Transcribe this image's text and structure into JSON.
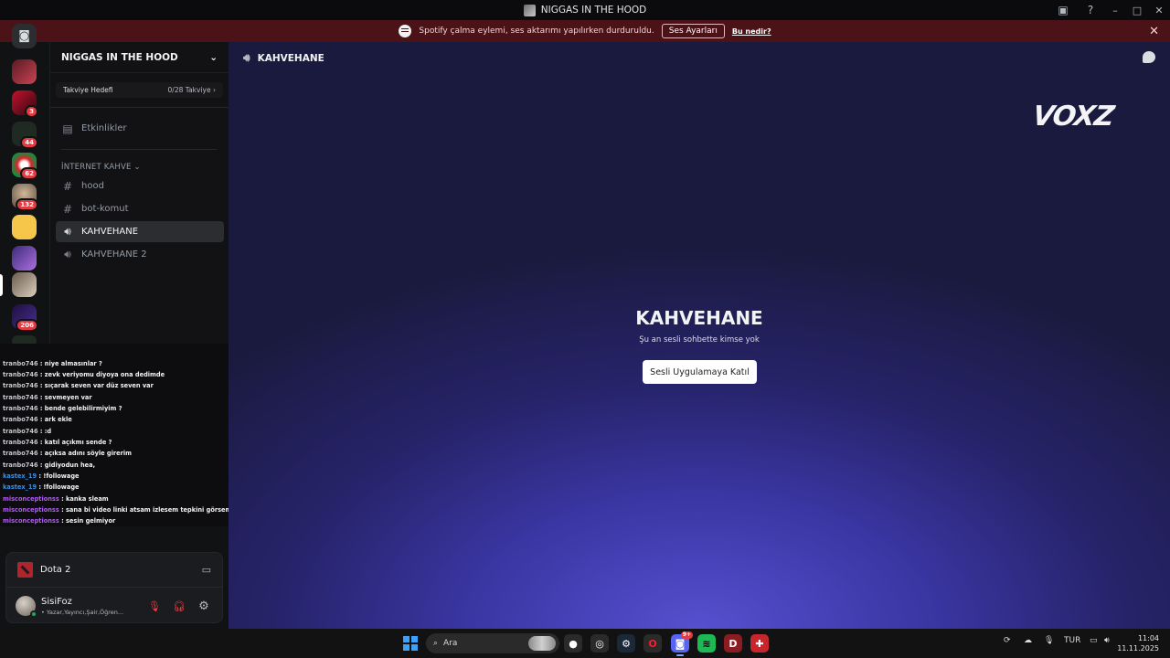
{
  "window": {
    "title": "NIGGAS IN THE HOOD",
    "controls": {
      "minimize": "–",
      "maximize": "□",
      "close": "✕"
    }
  },
  "notice": {
    "message": "Spotify çalma eylemi, ses aktarımı yapılırken durduruldu.",
    "button": "Ses Ayarları",
    "link": "Bu nedir?"
  },
  "server_rail": {
    "badges": [
      "3",
      "44",
      "62",
      "132",
      "206"
    ]
  },
  "sidebar": {
    "server_name": "NIGGAS IN THE HOOD",
    "boost": {
      "label": "Takviye Hedefi",
      "value": "0/28 Takviye"
    },
    "events": "Etkinlikler",
    "category": "İNTERNET KAHVE",
    "channels": [
      {
        "name": "hood",
        "type": "text"
      },
      {
        "name": "bot-komut",
        "type": "text"
      },
      {
        "name": "KAHVEHANE",
        "type": "voice",
        "active": true
      },
      {
        "name": "KAHVEHANE 2",
        "type": "voice"
      }
    ]
  },
  "chat_overlay": {
    "messages": [
      {
        "user": "tranbo746",
        "text": ": niye almasınlar ?"
      },
      {
        "user": "tranbo746",
        "text": ": zevk veriyomu diyoya ona dedimde"
      },
      {
        "user": "tranbo746",
        "text": ": sıçarak seven var düz seven var"
      },
      {
        "user": "tranbo746",
        "text": ": sevmeyen var"
      },
      {
        "user": "tranbo746",
        "text": ": bende gelebilirmiyim ?"
      },
      {
        "user": "tranbo746",
        "text": ": ark ekle"
      },
      {
        "user": "tranbo746",
        "text": ": :d"
      },
      {
        "user": "tranbo746",
        "text": ": katıl açıkmı sende ?"
      },
      {
        "user": "tranbo746",
        "text": ": açıksa adını söyle girerim"
      },
      {
        "user": "tranbo746",
        "text": ": gidiyodun hea,"
      },
      {
        "user": "kastex_19",
        "text": ": !followage"
      },
      {
        "user": "kastex_19",
        "text": ": !followage"
      },
      {
        "user": "misconceptionss",
        "text": ": kanka sleam"
      },
      {
        "user": "misconceptionss",
        "text": ": sana bi video linki atsam izlesem tepkini görsem sorun olur mu"
      },
      {
        "user": "misconceptionss",
        "text": ": sesin gelmiyor"
      }
    ]
  },
  "activity": {
    "game": "Dota 2"
  },
  "user_panel": {
    "name": "SisiFoz",
    "status": "• Yazar,Yayıncı,Şair,Öğren..."
  },
  "main": {
    "channel_name": "KAHVEHANE",
    "logo": "VOXZ",
    "empty_title": "KAHVEHANE",
    "empty_subtitle": "Şu an sesli sohbette kimse yok",
    "join_button": "Sesli Uygulamaya Katıl"
  },
  "taskbar": {
    "search_placeholder": "Ara",
    "discord_badge": "9+",
    "language": "TUR",
    "time": "11:04",
    "date": "11.11.2025"
  }
}
